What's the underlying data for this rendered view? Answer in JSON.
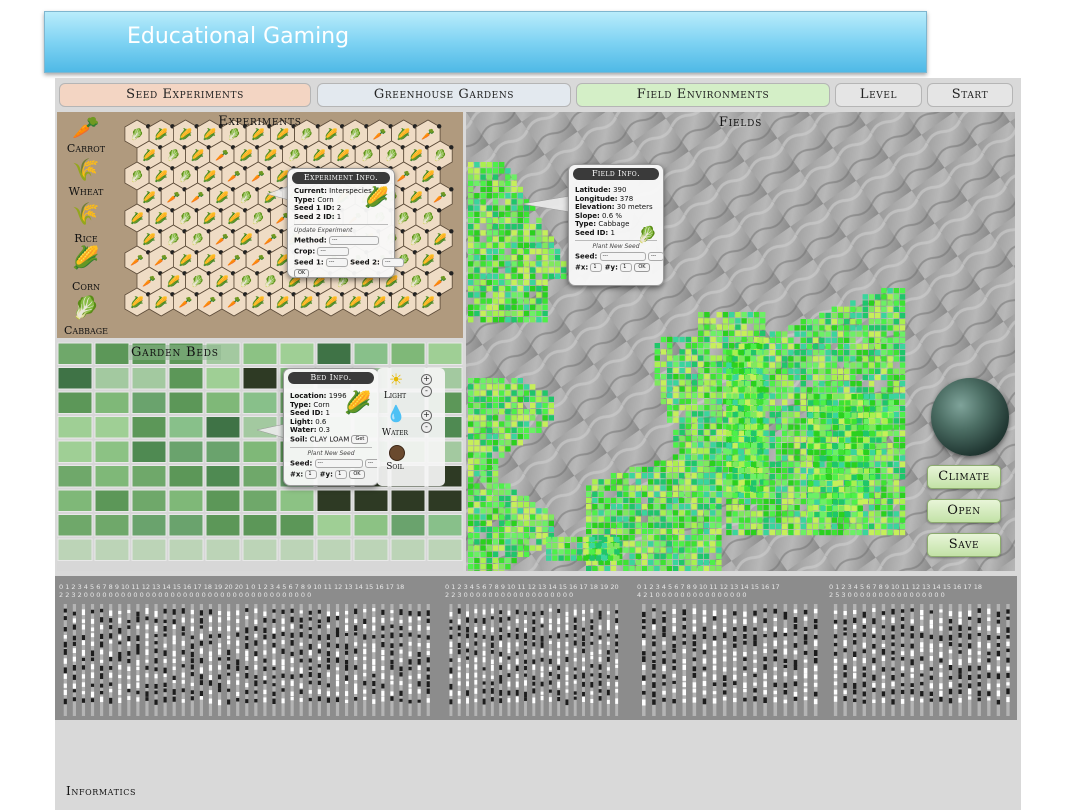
{
  "window": {
    "title": "Educational Gaming"
  },
  "tabs": [
    {
      "label": "Seed Experiments",
      "color": "#f3d5c3"
    },
    {
      "label": "Greenhouse Gardens",
      "color": "#e3e9ef"
    },
    {
      "label": "Field Environments",
      "color": "#d4efc7"
    },
    {
      "label": "Level",
      "color": "#e5e5e5"
    },
    {
      "label": "Start",
      "color": "#e5e5e5"
    }
  ],
  "experiments": {
    "title": "Experiments",
    "crops": [
      {
        "label": "Carrot",
        "icon": "carrot-icon",
        "glyph": "🥕"
      },
      {
        "label": "Wheat",
        "icon": "wheat-icon",
        "glyph": "🌾"
      },
      {
        "label": "Rice",
        "icon": "rice-icon",
        "glyph": "🌾"
      },
      {
        "label": "Corn",
        "icon": "corn-icon",
        "glyph": "🌽"
      },
      {
        "label": "Cabbage",
        "icon": "cabbage-icon",
        "glyph": "🥬"
      }
    ],
    "popup": {
      "title": "Experiment Info.",
      "current_label": "Current:",
      "current_value": "Interspecies",
      "type_label": "Type:",
      "type_value": "Corn",
      "seed1_label": "Seed 1 ID:",
      "seed1_value": "2",
      "seed2_label": "Seed 2 ID:",
      "seed2_value": "1",
      "update_title": "Update Experiment",
      "method_label": "Method:",
      "crop_label": "Crop:",
      "seed1_sel_label": "Seed 1:",
      "seed2_sel_label": "Seed 2:",
      "select_placeholder": "---",
      "ok_label": "OK"
    }
  },
  "garden": {
    "title": "Garden Beds",
    "popup": {
      "title": "Bed Info.",
      "location_label": "Location:",
      "location_value": "1996",
      "type_label": "Type:",
      "type_value": "Corn",
      "seed_label": "Seed ID:",
      "seed_value": "1",
      "light_label": "Light:",
      "light_value": "0.6",
      "water_label": "Water:",
      "water_value": "0.3",
      "soil_label": "Soil:",
      "soil_value": "CLAY LOAM",
      "get_label": "Get",
      "plant_title": "Plant New Seed",
      "seed_sel_label": "Seed:",
      "x_label": "#x:",
      "x_value": "1",
      "y_label": "#y:",
      "y_value": "1",
      "ok_label": "OK",
      "select_placeholder": "---"
    },
    "controls": {
      "light": "Light",
      "water": "Water",
      "soil": "Soil"
    }
  },
  "fields": {
    "title": "Fields",
    "popup": {
      "title": "Field Info.",
      "latitude_label": "Latitude:",
      "latitude_value": "390",
      "longitude_label": "Longitude:",
      "longitude_value": "378",
      "elevation_label": "Elevation:",
      "elevation_value": "30 meters",
      "slope_label": "Slope:",
      "slope_value": "0.6 %",
      "type_label": "Type:",
      "type_value": "Cabbage",
      "seed_label": "Seed ID:",
      "seed_value": "1",
      "plant_title": "Plant New Seed",
      "seed_sel_label": "Seed:",
      "x_label": "#x:",
      "x_value": "1",
      "y_label": "#y:",
      "y_value": "1",
      "ok_label": "OK",
      "select_placeholder": "---"
    },
    "buttons": {
      "climate": "Climate",
      "open": "Open",
      "save": "Save"
    }
  },
  "informatics": {
    "label": "Informatics",
    "groups": [
      {
        "numbers": "0 1 2 3 4 5 6 7 8 9 10 11 12 13 14 15 16 17 18 19 20 20 1 0 1 2 3 4 5 6 7 8 9 10 11 12 13 14 15 16 17 18",
        "counts": "2 2 3 2 0 0 0 0 0 0 0 0 0 0 0 0 0 0 0 0 0 0 0 0 0 0 0 0 0 0 0 0 0 0 0 0 0 0 0 0 0"
      },
      {
        "numbers": "0 1 2 3 4 5 6 7 8 9 10 11 12 13 14 15 16 17 18 19 20",
        "counts": "2 2 3 0 0 0 0 0 0 0 0 0 0 0 0 0 0 0 0 0 0"
      },
      {
        "numbers": "0 1 2 3 4 5 6 7 8 9 10 11 12 13 14 15 16 17",
        "counts": "4 2 1 0 0 0 0 0 0 0 0 0 0 0 0 0 0 0"
      },
      {
        "numbers": "0 1 2 3 4 5 6 7 8 9 10 11 12 13 14 15 16 17 18",
        "counts": "2 5 3 0 0 0 0 0 0 0 0 0 0 0 0 0 0 0 0"
      }
    ]
  }
}
